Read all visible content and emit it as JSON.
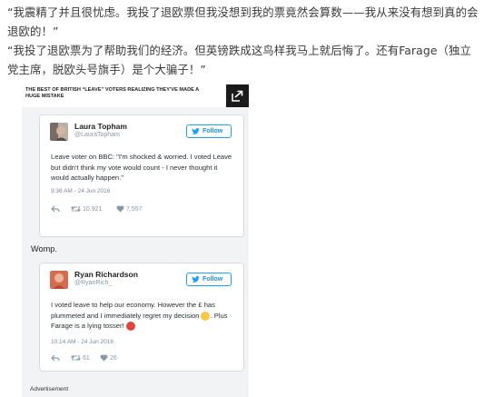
{
  "post": {
    "quote1": "“我震精了并且很忧虑。我投了退欧票但我没想到我的票竟然会算数——我从来没有想到真的会退欧的！”",
    "quote2": "“我投了退欧票为了帮助我们的经济。但英镑跌成这鸟样我马上就后悔了。还有Farage（独立党主席，脱欧头号旗手）是个大骗子！”"
  },
  "embed": {
    "banner_title": "THE BEST OF BRITISH “LEAVE” VOTERS REALIZING THEY'VE MADE A HUGE MISTAKE",
    "share_icon": "share-arrow-icon",
    "interlude": "Womp.",
    "advertisement_label": "Advertisement"
  },
  "tweets": [
    {
      "author": "Laura Topham",
      "handle": "@LauraTopham",
      "follow_label": "Follow",
      "text": "Leave voter on BBC: \"I'm shocked & worried. I voted Leave but didn't think my vote would count - I never thought it would actually happen.\"",
      "time": "9:36 AM - 24 Jun 2016",
      "retweets": "10,921",
      "likes": "7,557"
    },
    {
      "author": "Ryan Richardson",
      "handle": "@RyanRich_",
      "follow_label": "Follow",
      "text_part1": "I voted leave to help our economy. However the £ has plummeted and I immediately regret my decision",
      "text_part2": ". Plus Farage is a lying tosser!",
      "time": "10:14 AM - 24 Jun 2016",
      "retweets": "61",
      "likes": "26"
    }
  ],
  "colors": {
    "twitter_blue": "#1da1f2",
    "embed_background": "#f2f3f5",
    "banner_button": "#1b1b1b"
  }
}
